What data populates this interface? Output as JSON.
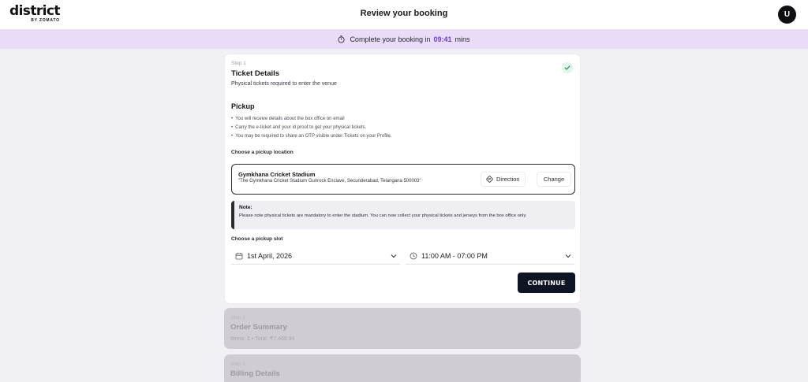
{
  "header": {
    "logo_text": "district",
    "logo_subtext": "BY ZOMATO",
    "title": "Review your booking",
    "avatar_initial": "U"
  },
  "timer": {
    "prefix": "Complete your booking in",
    "value": "09:41",
    "suffix": "mins",
    "accent_color": "#6b3ed0"
  },
  "ticket_step": {
    "step": "Step 1",
    "title": "Ticket Details",
    "subtitle": "Physical tickets required to enter the venue",
    "completed_icon": "check-icon",
    "pickup": {
      "title": "Pickup",
      "bullets": [
        "You will receive details about the box office on email",
        "Carry the e-ticket and your id proof to get your physical tickets.",
        "You may be required to share an OTP visible under Tickets on your Profile."
      ]
    },
    "location": {
      "label": "Choose a pickup location",
      "name": "Gymkhana Cricket Stadium",
      "address": "\"The Gymkhana Cricket Stadium Gunrock Enclave, Secunderabad, Telangana 500003\"",
      "direction_label": "Direction",
      "change_label": "Change"
    },
    "note": {
      "title": "Note:",
      "text": "Please note physical tickets are mandatory to enter the stadium. You can now collect your physical tickets and jerseys from the box office only."
    },
    "slot": {
      "label": "Choose a pickup slot",
      "date": "1st April, 2026",
      "time": "11:00 AM - 07:00 PM"
    },
    "continue_label": "CONTINUE"
  },
  "order_step": {
    "step": "Step 2",
    "title": "Order Summary",
    "subtitle": "Items: 1 • Total: ₹7,469.94"
  },
  "billing_step": {
    "step": "Step 3",
    "title": "Billing Details"
  }
}
